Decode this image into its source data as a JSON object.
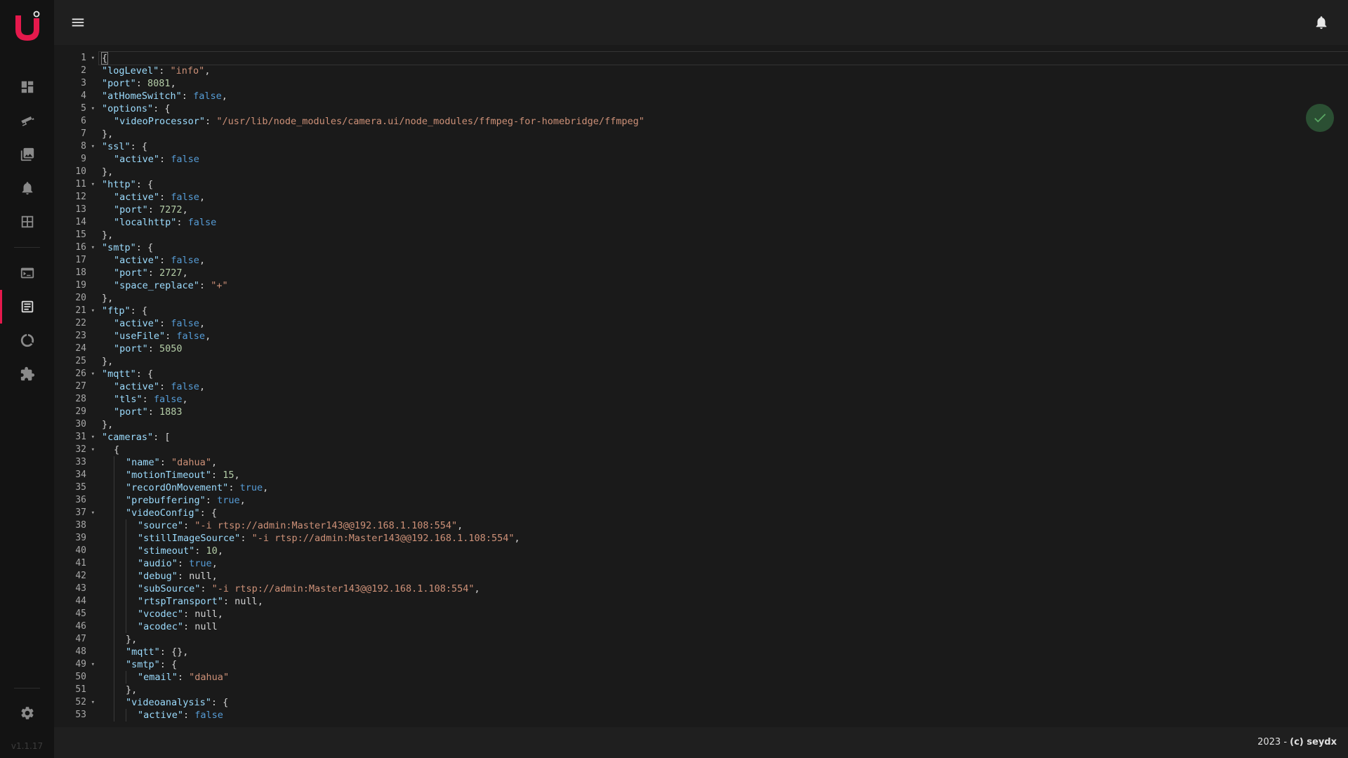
{
  "app": {
    "version": "v1.1.17",
    "footer_year": "2023 - ",
    "footer_author": "(c) seydx",
    "accent_color": "#e5194c"
  },
  "sidebar": {
    "items": [
      {
        "name": "dashboard-icon",
        "active": false
      },
      {
        "name": "cameras-icon",
        "active": false
      },
      {
        "name": "recordings-icon",
        "active": false
      },
      {
        "name": "notifications-icon",
        "active": false
      },
      {
        "name": "camview-icon",
        "active": false
      },
      {
        "name": "console-icon",
        "active": false
      },
      {
        "name": "config-icon",
        "active": true
      },
      {
        "name": "status-icon",
        "active": false
      },
      {
        "name": "plugins-icon",
        "active": false
      }
    ],
    "settings_icon": "gear-icon"
  },
  "editor": {
    "lines": [
      {
        "n": "1",
        "fold": true,
        "d": 0,
        "t": [
          [
            "p",
            "{"
          ]
        ]
      },
      {
        "n": "2",
        "fold": false,
        "d": 0,
        "t": [
          [
            "k",
            "\"logLevel\""
          ],
          [
            "p",
            ": "
          ],
          [
            "s",
            "\"info\""
          ],
          [
            "p",
            ","
          ]
        ]
      },
      {
        "n": "3",
        "fold": false,
        "d": 0,
        "t": [
          [
            "k",
            "\"port\""
          ],
          [
            "p",
            ": "
          ],
          [
            "n",
            "8081"
          ],
          [
            "p",
            ","
          ]
        ]
      },
      {
        "n": "4",
        "fold": false,
        "d": 0,
        "t": [
          [
            "k",
            "\"atHomeSwitch\""
          ],
          [
            "p",
            ": "
          ],
          [
            "b",
            "false"
          ],
          [
            "p",
            ","
          ]
        ]
      },
      {
        "n": "5",
        "fold": true,
        "d": 0,
        "t": [
          [
            "k",
            "\"options\""
          ],
          [
            "p",
            ": {"
          ]
        ]
      },
      {
        "n": "6",
        "fold": false,
        "d": 1,
        "t": [
          [
            "k",
            "\"videoProcessor\""
          ],
          [
            "p",
            ": "
          ],
          [
            "s",
            "\"/usr/lib/node_modules/camera.ui/node_modules/ffmpeg-for-homebridge/ffmpeg\""
          ]
        ]
      },
      {
        "n": "7",
        "fold": false,
        "d": 0,
        "t": [
          [
            "p",
            "},"
          ]
        ]
      },
      {
        "n": "8",
        "fold": true,
        "d": 0,
        "t": [
          [
            "k",
            "\"ssl\""
          ],
          [
            "p",
            ": {"
          ]
        ]
      },
      {
        "n": "9",
        "fold": false,
        "d": 1,
        "t": [
          [
            "k",
            "\"active\""
          ],
          [
            "p",
            ": "
          ],
          [
            "b",
            "false"
          ]
        ]
      },
      {
        "n": "10",
        "fold": false,
        "d": 0,
        "t": [
          [
            "p",
            "},"
          ]
        ]
      },
      {
        "n": "11",
        "fold": true,
        "d": 0,
        "t": [
          [
            "k",
            "\"http\""
          ],
          [
            "p",
            ": {"
          ]
        ]
      },
      {
        "n": "12",
        "fold": false,
        "d": 1,
        "t": [
          [
            "k",
            "\"active\""
          ],
          [
            "p",
            ": "
          ],
          [
            "b",
            "false"
          ],
          [
            "p",
            ","
          ]
        ]
      },
      {
        "n": "13",
        "fold": false,
        "d": 1,
        "t": [
          [
            "k",
            "\"port\""
          ],
          [
            "p",
            ": "
          ],
          [
            "n",
            "7272"
          ],
          [
            "p",
            ","
          ]
        ]
      },
      {
        "n": "14",
        "fold": false,
        "d": 1,
        "t": [
          [
            "k",
            "\"localhttp\""
          ],
          [
            "p",
            ": "
          ],
          [
            "b",
            "false"
          ]
        ]
      },
      {
        "n": "15",
        "fold": false,
        "d": 0,
        "t": [
          [
            "p",
            "},"
          ]
        ]
      },
      {
        "n": "16",
        "fold": true,
        "d": 0,
        "t": [
          [
            "k",
            "\"smtp\""
          ],
          [
            "p",
            ": {"
          ]
        ]
      },
      {
        "n": "17",
        "fold": false,
        "d": 1,
        "t": [
          [
            "k",
            "\"active\""
          ],
          [
            "p",
            ": "
          ],
          [
            "b",
            "false"
          ],
          [
            "p",
            ","
          ]
        ]
      },
      {
        "n": "18",
        "fold": false,
        "d": 1,
        "t": [
          [
            "k",
            "\"port\""
          ],
          [
            "p",
            ": "
          ],
          [
            "n",
            "2727"
          ],
          [
            "p",
            ","
          ]
        ]
      },
      {
        "n": "19",
        "fold": false,
        "d": 1,
        "t": [
          [
            "k",
            "\"space_replace\""
          ],
          [
            "p",
            ": "
          ],
          [
            "s",
            "\"+\""
          ]
        ]
      },
      {
        "n": "20",
        "fold": false,
        "d": 0,
        "t": [
          [
            "p",
            "},"
          ]
        ]
      },
      {
        "n": "21",
        "fold": true,
        "d": 0,
        "t": [
          [
            "k",
            "\"ftp\""
          ],
          [
            "p",
            ": {"
          ]
        ]
      },
      {
        "n": "22",
        "fold": false,
        "d": 1,
        "t": [
          [
            "k",
            "\"active\""
          ],
          [
            "p",
            ": "
          ],
          [
            "b",
            "false"
          ],
          [
            "p",
            ","
          ]
        ]
      },
      {
        "n": "23",
        "fold": false,
        "d": 1,
        "t": [
          [
            "k",
            "\"useFile\""
          ],
          [
            "p",
            ": "
          ],
          [
            "b",
            "false"
          ],
          [
            "p",
            ","
          ]
        ]
      },
      {
        "n": "24",
        "fold": false,
        "d": 1,
        "t": [
          [
            "k",
            "\"port\""
          ],
          [
            "p",
            ": "
          ],
          [
            "n",
            "5050"
          ]
        ]
      },
      {
        "n": "25",
        "fold": false,
        "d": 0,
        "t": [
          [
            "p",
            "},"
          ]
        ]
      },
      {
        "n": "26",
        "fold": true,
        "d": 0,
        "t": [
          [
            "k",
            "\"mqtt\""
          ],
          [
            "p",
            ": {"
          ]
        ]
      },
      {
        "n": "27",
        "fold": false,
        "d": 1,
        "t": [
          [
            "k",
            "\"active\""
          ],
          [
            "p",
            ": "
          ],
          [
            "b",
            "false"
          ],
          [
            "p",
            ","
          ]
        ]
      },
      {
        "n": "28",
        "fold": false,
        "d": 1,
        "t": [
          [
            "k",
            "\"tls\""
          ],
          [
            "p",
            ": "
          ],
          [
            "b",
            "false"
          ],
          [
            "p",
            ","
          ]
        ]
      },
      {
        "n": "29",
        "fold": false,
        "d": 1,
        "t": [
          [
            "k",
            "\"port\""
          ],
          [
            "p",
            ": "
          ],
          [
            "n",
            "1883"
          ]
        ]
      },
      {
        "n": "30",
        "fold": false,
        "d": 0,
        "t": [
          [
            "p",
            "},"
          ]
        ]
      },
      {
        "n": "31",
        "fold": true,
        "d": 0,
        "t": [
          [
            "k",
            "\"cameras\""
          ],
          [
            "p",
            ": ["
          ]
        ]
      },
      {
        "n": "32",
        "fold": true,
        "d": 1,
        "t": [
          [
            "p",
            "{"
          ]
        ]
      },
      {
        "n": "33",
        "fold": false,
        "d": 2,
        "t": [
          [
            "k",
            "\"name\""
          ],
          [
            "p",
            ": "
          ],
          [
            "s",
            "\"dahua\""
          ],
          [
            "p",
            ","
          ]
        ]
      },
      {
        "n": "34",
        "fold": false,
        "d": 2,
        "t": [
          [
            "k",
            "\"motionTimeout\""
          ],
          [
            "p",
            ": "
          ],
          [
            "n",
            "15"
          ],
          [
            "p",
            ","
          ]
        ]
      },
      {
        "n": "35",
        "fold": false,
        "d": 2,
        "t": [
          [
            "k",
            "\"recordOnMovement\""
          ],
          [
            "p",
            ": "
          ],
          [
            "b",
            "true"
          ],
          [
            "p",
            ","
          ]
        ]
      },
      {
        "n": "36",
        "fold": false,
        "d": 2,
        "t": [
          [
            "k",
            "\"prebuffering\""
          ],
          [
            "p",
            ": "
          ],
          [
            "b",
            "true"
          ],
          [
            "p",
            ","
          ]
        ]
      },
      {
        "n": "37",
        "fold": true,
        "d": 2,
        "t": [
          [
            "k",
            "\"videoConfig\""
          ],
          [
            "p",
            ": {"
          ]
        ]
      },
      {
        "n": "38",
        "fold": false,
        "d": 3,
        "t": [
          [
            "k",
            "\"source\""
          ],
          [
            "p",
            ": "
          ],
          [
            "s",
            "\"-i rtsp://admin:Master143@@192.168.1.108:554\""
          ],
          [
            "p",
            ","
          ]
        ]
      },
      {
        "n": "39",
        "fold": false,
        "d": 3,
        "t": [
          [
            "k",
            "\"stillImageSource\""
          ],
          [
            "p",
            ": "
          ],
          [
            "s",
            "\"-i rtsp://admin:Master143@@192.168.1.108:554\""
          ],
          [
            "p",
            ","
          ]
        ]
      },
      {
        "n": "40",
        "fold": false,
        "d": 3,
        "t": [
          [
            "k",
            "\"stimeout\""
          ],
          [
            "p",
            ": "
          ],
          [
            "n",
            "10"
          ],
          [
            "p",
            ","
          ]
        ]
      },
      {
        "n": "41",
        "fold": false,
        "d": 3,
        "t": [
          [
            "k",
            "\"audio\""
          ],
          [
            "p",
            ": "
          ],
          [
            "b",
            "true"
          ],
          [
            "p",
            ","
          ]
        ]
      },
      {
        "n": "42",
        "fold": false,
        "d": 3,
        "t": [
          [
            "k",
            "\"debug\""
          ],
          [
            "p",
            ": null,"
          ]
        ]
      },
      {
        "n": "43",
        "fold": false,
        "d": 3,
        "t": [
          [
            "k",
            "\"subSource\""
          ],
          [
            "p",
            ": "
          ],
          [
            "s",
            "\"-i rtsp://admin:Master143@@192.168.1.108:554\""
          ],
          [
            "p",
            ","
          ]
        ]
      },
      {
        "n": "44",
        "fold": false,
        "d": 3,
        "t": [
          [
            "k",
            "\"rtspTransport\""
          ],
          [
            "p",
            ": null,"
          ]
        ]
      },
      {
        "n": "45",
        "fold": false,
        "d": 3,
        "t": [
          [
            "k",
            "\"vcodec\""
          ],
          [
            "p",
            ": null,"
          ]
        ]
      },
      {
        "n": "46",
        "fold": false,
        "d": 3,
        "t": [
          [
            "k",
            "\"acodec\""
          ],
          [
            "p",
            ": null"
          ]
        ]
      },
      {
        "n": "47",
        "fold": false,
        "d": 2,
        "t": [
          [
            "p",
            "},"
          ]
        ]
      },
      {
        "n": "48",
        "fold": false,
        "d": 2,
        "t": [
          [
            "k",
            "\"mqtt\""
          ],
          [
            "p",
            ": {},"
          ]
        ]
      },
      {
        "n": "49",
        "fold": true,
        "d": 2,
        "t": [
          [
            "k",
            "\"smtp\""
          ],
          [
            "p",
            ": {"
          ]
        ]
      },
      {
        "n": "50",
        "fold": false,
        "d": 3,
        "t": [
          [
            "k",
            "\"email\""
          ],
          [
            "p",
            ": "
          ],
          [
            "s",
            "\"dahua\""
          ]
        ]
      },
      {
        "n": "51",
        "fold": false,
        "d": 2,
        "t": [
          [
            "p",
            "},"
          ]
        ]
      },
      {
        "n": "52",
        "fold": true,
        "d": 2,
        "t": [
          [
            "k",
            "\"videoanalysis\""
          ],
          [
            "p",
            ": {"
          ]
        ]
      },
      {
        "n": "53",
        "fold": false,
        "d": 3,
        "t": [
          [
            "k",
            "\"active\""
          ],
          [
            "p",
            ": "
          ],
          [
            "b",
            "false"
          ]
        ]
      }
    ]
  }
}
